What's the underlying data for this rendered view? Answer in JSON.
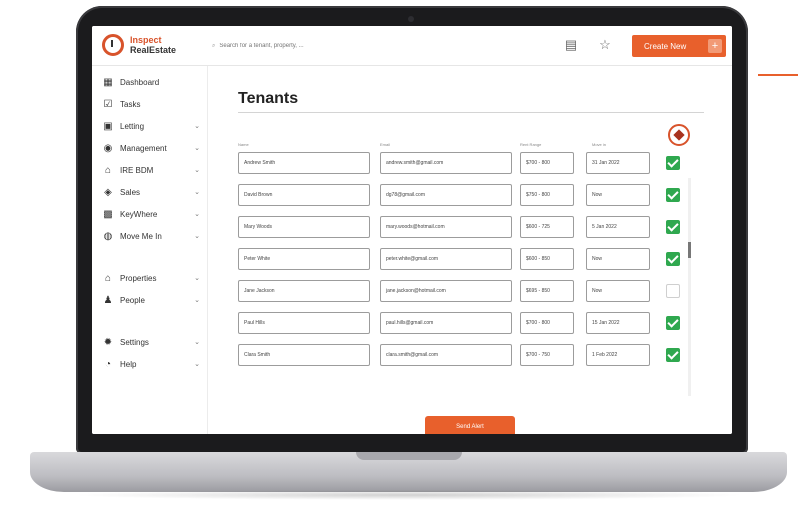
{
  "app": {
    "logo_line1": "Inspect",
    "logo_line2": "RealEstate"
  },
  "topbar": {
    "search_placeholder": "Search for a tenant, property, ...",
    "search_icon": "search-icon",
    "doc_icon": "document-alert-icon",
    "star_icon": "star-icon",
    "create_label": "Create New",
    "create_plus": "+"
  },
  "sidebar": {
    "items": [
      {
        "label": "Dashboard",
        "icon": "dashboard-icon",
        "chevron": ""
      },
      {
        "label": "Tasks",
        "icon": "tasks-icon",
        "chevron": ""
      },
      {
        "label": "Letting",
        "icon": "letting-icon",
        "chevron": "⌄"
      },
      {
        "label": "Management",
        "icon": "management-icon",
        "chevron": "⌄"
      },
      {
        "label": "IRE BDM",
        "icon": "bdm-icon",
        "chevron": "⌄"
      },
      {
        "label": "Sales",
        "icon": "sales-icon",
        "chevron": "⌄"
      },
      {
        "label": "KeyWhere",
        "icon": "key-icon",
        "chevron": "⌄"
      },
      {
        "label": "Move Me In",
        "icon": "move-icon",
        "chevron": "⌄"
      },
      {
        "label": "Properties",
        "icon": "home-icon",
        "chevron": "⌄"
      },
      {
        "label": "People",
        "icon": "people-icon",
        "chevron": "⌄"
      },
      {
        "label": "Settings",
        "icon": "gear-icon",
        "chevron": "⌄"
      },
      {
        "label": "Help",
        "icon": "help-icon",
        "chevron": "⌄"
      }
    ]
  },
  "main": {
    "title": "Tenants",
    "columns": {
      "name": "Name",
      "email": "Email",
      "price": "Rent Range",
      "date": "Move in"
    },
    "rows": [
      {
        "name": "Andrew Smith",
        "email": "andrew.smith@gmail.com",
        "price": "$700 - 800",
        "date": "31 Jan 2022",
        "checked": true
      },
      {
        "name": "David Brown",
        "email": "dg78@gmail.com",
        "price": "$750 - 800",
        "date": "Now",
        "checked": true
      },
      {
        "name": "Mary Woods",
        "email": "mary.woods@hotmail.com",
        "price": "$600 - 725",
        "date": "5 Jan 2022",
        "checked": true
      },
      {
        "name": "Peter White",
        "email": "peter.white@gmail.com",
        "price": "$600 - 850",
        "date": "Now",
        "checked": true
      },
      {
        "name": "Jane Jackson",
        "email": "jane.jackson@hotmail.com",
        "price": "$695 - 850",
        "date": "Now",
        "checked": false
      },
      {
        "name": "Paul Hills",
        "email": "paul.hills@gmail.com",
        "price": "$700 - 800",
        "date": "15 Jan 2022",
        "checked": true
      },
      {
        "name": "Clara Smith",
        "email": "clara.smith@gmail.com",
        "price": "$700 - 750",
        "date": "1 Feb 2022",
        "checked": true
      }
    ],
    "send_label": "Send Alert"
  },
  "colors": {
    "accent": "#e8602c",
    "brand_red": "#d8532b",
    "check_green": "#2fa84f"
  }
}
